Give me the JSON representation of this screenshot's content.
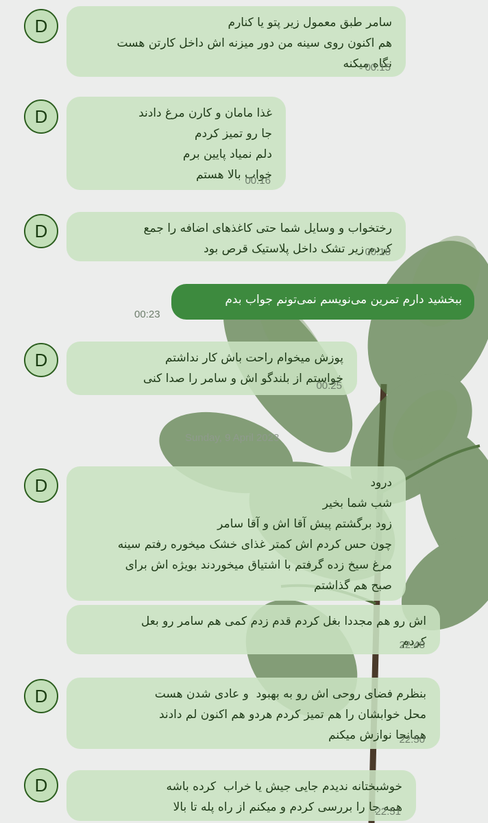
{
  "avatar_letter": "D",
  "date_separator": "Sunday, 9 April 2023",
  "messages": [
    {
      "text": "سامر طبق معمول زیر پتو یا کنارم\nهم اکنون روی سینه من دور میزنه اش داخل کارتن هست\nنگاه میکنه",
      "time": "00:15"
    },
    {
      "text": "غذا مامان و کارن مرغ دادند\nجا رو تمیز کردم\nدلم نمیاد پایین برم\nخواب بالا هستم",
      "time": "00:16"
    },
    {
      "text": "رختخواب و وسایل شما حتی کاغذهای اضافه را جمع\nکردم زیر تشک داخل پلاستیک قرص بود",
      "time": "00:18"
    },
    {
      "text": "پوزش میخوام راحت باش کار نداشتم\nخواستم از بلندگو اش و سامر را صدا کنی",
      "time": "00:25"
    },
    {
      "text": "درود\nشب شما بخیر\nزود برگشتم پیش آقا اش و آقا سامر\nچون حس کردم اش کمتر غذای خشک میخوره رفتم سینه\nمرغ سیخ زده گرفتم با اشتیاق میخوردند بویژه اش برای\nصبح هم گذاشتم",
      "time": ""
    },
    {
      "text": "اش رو هم مجددا بغل کردم قدم زدم کمی هم سامر رو بعل\nکردم",
      "time": "22:48"
    },
    {
      "text": "بنظرم فضای روحی اش رو به بهبود  و عادی شدن هست\nمحل خوابشان را هم تمیز کردم هردو هم اکنون لم دادند\nهمانجا نوازش میکنم",
      "time": "22:50"
    },
    {
      "text": "خوشبختانه ندیدم جایی جیش یا خراب  کرده باشه\nهمه جا را بررسی کردم و میکنم از راه پله تا بالا",
      "time": "22:51"
    }
  ],
  "outgoing": {
    "text": "ببخشید دارم تمرین می‌نویسم نمی‌تونم جواب بدم",
    "time": "00:23"
  }
}
